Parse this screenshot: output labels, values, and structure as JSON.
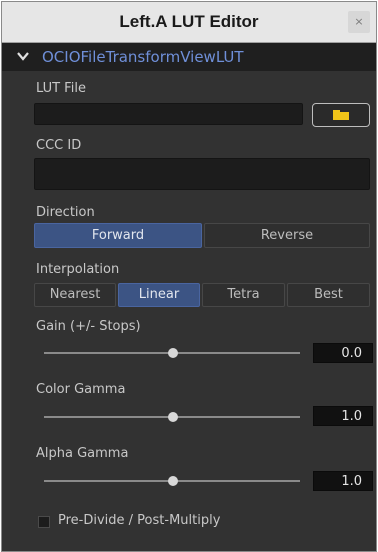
{
  "window": {
    "title": "Left.A LUT Editor",
    "close_glyph": "×"
  },
  "section": {
    "title": "OCIOFileTransformViewLUT",
    "chevron_icon": "chevron-down-icon"
  },
  "lut_file": {
    "label": "LUT File",
    "value": "",
    "browse_icon": "folder-icon"
  },
  "ccc_id": {
    "label": "CCC ID",
    "value": ""
  },
  "direction": {
    "label": "Direction",
    "options": [
      "Forward",
      "Reverse"
    ],
    "selected": "Forward"
  },
  "interpolation": {
    "label": "Interpolation",
    "options": [
      "Nearest",
      "Linear",
      "Tetra",
      "Best"
    ],
    "selected": "Linear"
  },
  "gain": {
    "label": "Gain (+/- Stops)",
    "value": "0.0"
  },
  "color_gamma": {
    "label": "Color Gamma",
    "value": "1.0"
  },
  "alpha_gamma": {
    "label": "Alpha Gamma",
    "value": "1.0"
  },
  "predivide": {
    "label": "Pre-Divide / Post-Multiply",
    "checked": false
  },
  "colors": {
    "panel_bg": "#323232",
    "accent": "#3c5484",
    "section_title": "#6f8fd8",
    "folder": "#f0c419"
  }
}
